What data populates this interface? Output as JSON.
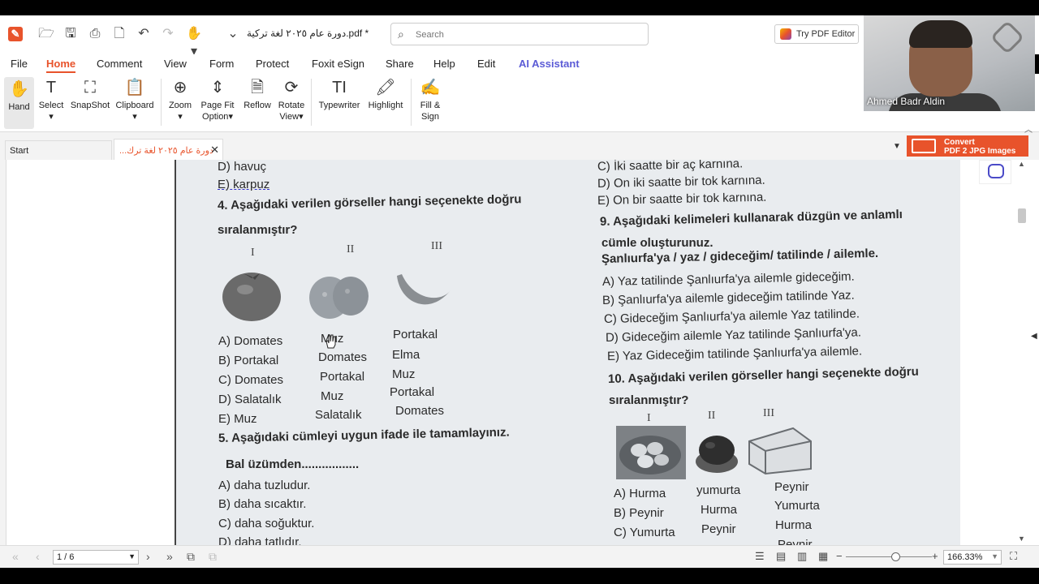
{
  "app": {
    "doc_title": "دورة عام ٢٠٢٥ لغة تركية.pdf *",
    "search_placeholder": "Search",
    "try_editor": "Try PDF Editor"
  },
  "menu": [
    "File",
    "Home",
    "Comment",
    "View",
    "Form",
    "Protect",
    "Foxit eSign",
    "Share",
    "Help",
    "Edit",
    "AI Assistant"
  ],
  "ribbon": {
    "hand": "Hand",
    "select": "Select",
    "snapshot": "SnapShot",
    "clipboard": "Clipboard",
    "zoom": "Zoom",
    "page_fit_1": "Page Fit",
    "page_fit_2": "Option",
    "reflow": "Reflow",
    "rotate_1": "Rotate",
    "rotate_2": "View",
    "typewriter": "Typewriter",
    "highlight": "Highlight",
    "fill_1": "Fill &",
    "fill_2": "Sign"
  },
  "video": {
    "name": "Ahmed Badr Aldin"
  },
  "tabs": {
    "start": "Start",
    "doc": "...دورة عام ٢٠٢٥ لغة ترك",
    "convert_1": "Convert",
    "convert_2": "PDF 2 JPG Images"
  },
  "page": {
    "left": {
      "l1": "D)  havuç",
      "l2": "E)  karpuz",
      "q4a": "4. Aşağıdaki verilen görseller hangi seçenekte doğru",
      "q4b": "sıralanmıştır?",
      "r1": "I",
      "r2": "II",
      "r3": "III",
      "a": [
        "A)  Domates",
        "Muz",
        "Portakal"
      ],
      "b": [
        "B) Portakal",
        "Domates",
        "Elma"
      ],
      "c": [
        "C)  Domates",
        "Portakal",
        "Muz"
      ],
      "d": [
        "D)  Salatalık",
        "Muz",
        "Portakal"
      ],
      "e": [
        "E)  Muz",
        "Salatalık",
        "Domates"
      ],
      "q5a": "5. Aşağıdaki cümleyi uygun ifade ile tamamlayınız.",
      "q5b": "Bal üzümden.................",
      "q5A": "A)  daha tuzludur.",
      "q5B": "B)  daha sıcaktır.",
      "q5C": "C)  daha soğuktur.",
      "q5D": "D)  daha tatlıdır."
    },
    "right": {
      "c8": "C)  İki saatte bir aç karnına.",
      "d8": "D)  On iki saatte bir tok karnına.",
      "e8": "E)  On bir saatte bir tok karnına.",
      "q9a": "9. Aşağıdaki kelimeleri kullanarak düzgün ve anlamlı",
      "q9b": "cümle oluşturunuz.",
      "q9c": "Şanlıurfa'ya / yaz / gideceğim/ tatilinde / ailemle.",
      "q9A": "A)  Yaz tatilinde Şanlıurfa'ya ailemle gideceğim.",
      "q9B": "B)  Şanlıurfa'ya ailemle gideceğim tatilinde Yaz.",
      "q9C": "C)  Gideceğim Şanlıurfa'ya ailemle Yaz tatilinde.",
      "q9D": "D)  Gideceğim ailemle Yaz tatilinde Şanlıurfa'ya.",
      "q9E": "E)  Yaz Gideceğim tatilinde Şanlıurfa'ya ailemle.",
      "q10a": "10. Aşağıdaki verilen görseller hangi seçenekte doğru",
      "q10b": "sıralanmıştır?",
      "r1": "I",
      "r2": "II",
      "r3": "III",
      "a": [
        "A) Hurma",
        "yumurta",
        "Peynir"
      ],
      "b": [
        "B)  Peynir",
        "Hurma",
        "Yumurta"
      ],
      "c": [
        "C)  Yumurta",
        "Peynir",
        "Hurma"
      ],
      "d_partial": "Peynir"
    }
  },
  "status": {
    "page": "1 / 6",
    "zoom": "166.33%"
  }
}
